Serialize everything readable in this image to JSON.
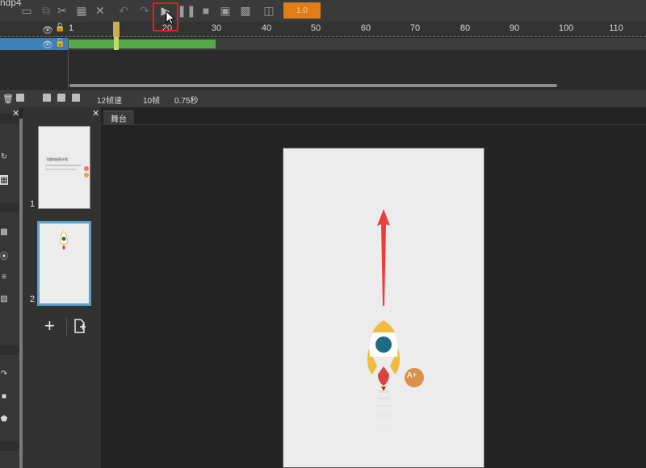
{
  "app": {
    "title": "ndp4"
  },
  "toolbar": {
    "icons": [
      "new-icon",
      "save-icon",
      "cut-icon",
      "paste-icon",
      "delete-icon",
      "undo-icon",
      "redo-icon",
      "play-icon",
      "pause-icon",
      "stop-icon",
      "preview-icon",
      "grid-icon",
      "publish-icon"
    ],
    "orange_label": "1.0"
  },
  "timeline": {
    "ruler_numbers": [
      "1",
      "10",
      "20",
      "30",
      "40",
      "50",
      "60",
      "70",
      "80",
      "90",
      "100",
      "110"
    ],
    "current_frame": "10",
    "colors": {
      "layer_selected": "#3d7fb7",
      "keyframes": "#58a94a",
      "playhead": "#bfd86f"
    }
  },
  "status": {
    "fps": "12帧速",
    "frames": "10帧",
    "duration": "0.75秒"
  },
  "pages_panel": {
    "pages": [
      {
        "number": "1",
        "thumb_title": "飞翔的秘密计划"
      },
      {
        "number": "2"
      }
    ]
  },
  "stage": {
    "tab_label": "舞台",
    "badge_label": "A+",
    "colors": {
      "arrow": "#ef3b3b",
      "rocket_body": "#ffffff",
      "rocket_wing": "#f0bb3e",
      "rocket_window": "#1e6b84",
      "badge": "#d9924a",
      "highlight_box": "#e2211c"
    }
  }
}
